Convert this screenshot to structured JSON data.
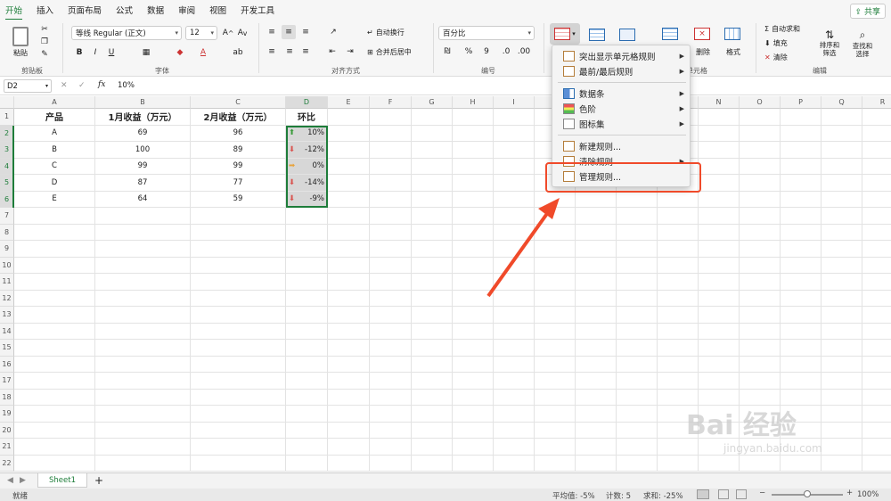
{
  "tabs": {
    "items": [
      "开始",
      "插入",
      "页面布局",
      "公式",
      "数据",
      "审阅",
      "视图",
      "开发工具"
    ],
    "share": "共享"
  },
  "ribbon": {
    "paste": "粘贴",
    "clipboard": "剪贴板",
    "font_name": "等线 Regular (正文)",
    "font_size": "12",
    "font_group": "字体",
    "wrap_text": "自动换行",
    "merge_center": "合并后居中",
    "align_group": "对齐方式",
    "number_format": "百分比",
    "number_group": "编号",
    "delete": "删除",
    "format": "格式",
    "cells_group": "单元格",
    "autosum": "自动求和",
    "fill": "填充",
    "clear": "清除",
    "sort_filter": "排序和\n筛选",
    "find_select": "查找和\n选择",
    "edit_group": "编辑"
  },
  "formula": {
    "namebox": "D2",
    "fx": "fx",
    "value": "10%"
  },
  "sheet": {
    "columns": [
      "A",
      "B",
      "C",
      "D",
      "E",
      "F",
      "G",
      "H",
      "I",
      "J",
      "K",
      "L",
      "M",
      "N",
      "O",
      "P",
      "Q",
      "R"
    ],
    "rows": [
      "1",
      "2",
      "3",
      "4",
      "5",
      "6",
      "7",
      "8",
      "9",
      "10",
      "11",
      "12",
      "13",
      "14",
      "15",
      "16",
      "17",
      "18",
      "19",
      "20",
      "21",
      "22"
    ],
    "headers": [
      "产品",
      "1月收益（万元）",
      "2月收益（万元）",
      "环比"
    ],
    "data": [
      [
        "A",
        "69",
        "96",
        "10%",
        "up"
      ],
      [
        "B",
        "100",
        "89",
        "-12%",
        "down"
      ],
      [
        "C",
        "99",
        "99",
        "0%",
        "flat"
      ],
      [
        "D",
        "87",
        "77",
        "-14%",
        "down"
      ],
      [
        "E",
        "64",
        "59",
        "-9%",
        "down"
      ]
    ],
    "tab": "Sheet1",
    "add": "+"
  },
  "menu": {
    "items": [
      "突出显示单元格规则",
      "最前/最后规则",
      "数据条",
      "色阶",
      "图标集",
      "新建规则...",
      "清除规则",
      "管理规则..."
    ]
  },
  "status": {
    "ready": "就绪",
    "avg": "平均值: -5%",
    "count": "计数: 5",
    "sum": "求和: -25%",
    "zoom": "100%"
  },
  "watermark": {
    "brand": "Bai 经验",
    "url": "jingyan.baidu.com"
  },
  "colors": {
    "accent": "#1e7d3a",
    "up": "#3a9b3a",
    "down": "#d9534f",
    "flat": "#e8a33b",
    "highlight": "#f04a2a"
  }
}
